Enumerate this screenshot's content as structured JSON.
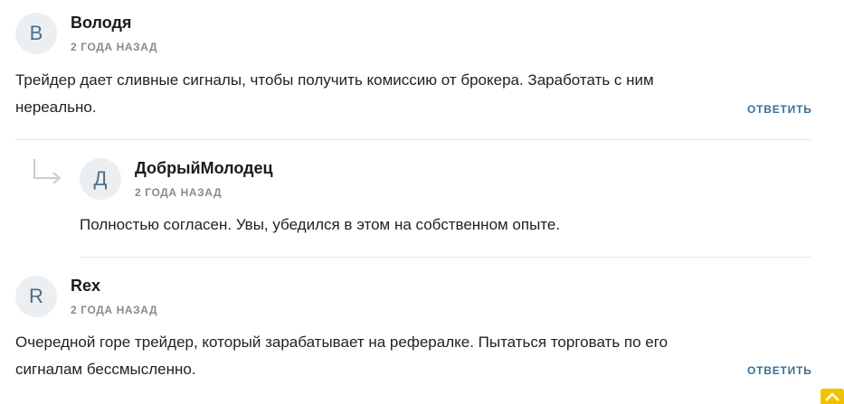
{
  "comments": [
    {
      "avatar_letter": "В",
      "author": "Володя",
      "time": "2 ГОДА НАЗАД",
      "text": "Трейдер дает сливные сигналы, чтобы получить комиссию от брокера. Заработать с ним нереально.",
      "reply_label": "ОТВЕТИТЬ"
    },
    {
      "avatar_letter": "Д",
      "author": "ДобрыйМолодец",
      "time": "2 ГОДА НАЗАД",
      "text": "Полностью согласен. Увы, убедился в этом на собственном опыте."
    },
    {
      "avatar_letter": "R",
      "author": "Rex",
      "time": "2 ГОДА НАЗАД",
      "text": "Очередной горе трейдер, который зарабатывает на рефералке. Пытаться торговать по его сигналам бессмысленно.",
      "reply_label": "ОТВЕТИТЬ"
    }
  ],
  "colors": {
    "avatar_bg": "#eceff1",
    "avatar_text": "#4a6f8a",
    "reply_link": "#3b6f95",
    "scroll_button": "#f2c200"
  },
  "icons": {
    "reply_indent": "reply-arrow-icon",
    "scroll_top": "chevron-up-icon"
  }
}
